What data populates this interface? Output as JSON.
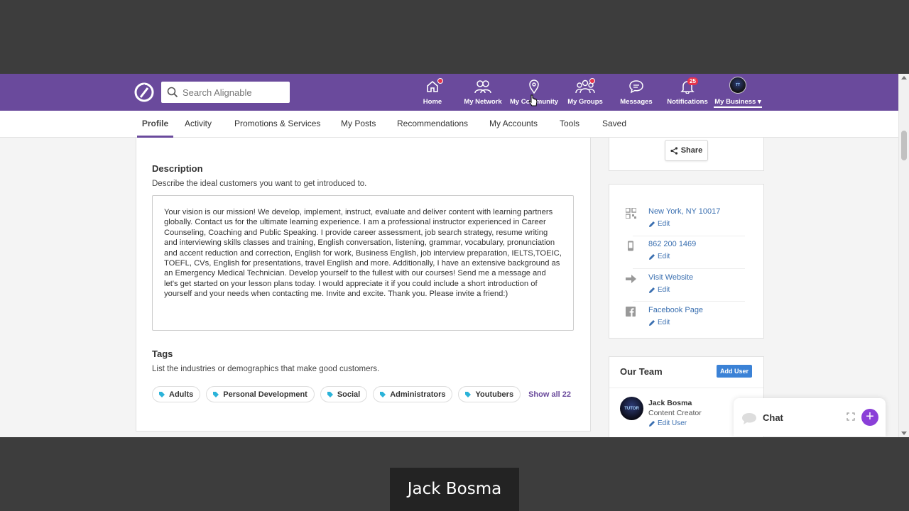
{
  "search": {
    "placeholder": "Search Alignable"
  },
  "nav": [
    {
      "label": "Home",
      "icon": "home-icon"
    },
    {
      "label": "My Network",
      "icon": "network-icon"
    },
    {
      "label": "My Community",
      "icon": "location-pin-icon"
    },
    {
      "label": "My Groups",
      "icon": "groups-icon"
    },
    {
      "label": "Messages",
      "icon": "chat-bubble-icon"
    },
    {
      "label": "Notifications",
      "icon": "bell-icon",
      "badge": "25"
    },
    {
      "label": "My Business",
      "icon": "business-avatar"
    }
  ],
  "tabs": [
    "Profile",
    "Activity",
    "Promotions & Services",
    "My Posts",
    "Recommendations",
    "My Accounts",
    "Tools",
    "Saved"
  ],
  "description": {
    "title": "Description",
    "subtitle": "Describe the ideal customers you want to get introduced to.",
    "text": "Your vision is our mission! We develop, implement, instruct, evaluate and deliver content with learning partners globally. Contact us for the ultimate learning experience. I am a professional instructor experienced in Career Counseling, Coaching and Public Speaking. I provide career assessment, job search strategy, resume writing and interviewing skills classes and training, English conversation, listening, grammar, vocabulary, pronunciation and accent reduction and correction, English for work, Business English, job interview preparation, IELTS,TOEIC, TOEFL, CVs, English for presentations, travel English and more. Additionally, I have an extensive background as an Emergency Medical Technician. Develop yourself to the fullest with our courses! Send me a message and let's get started on your lesson plans today. I would appreciate it if you could include a short introduction of yourself and your needs when contacting me. Invite and excite. Thank you. Please invite a friend:)"
  },
  "tags": {
    "title": "Tags",
    "subtitle": "List the industries or demographics that make good customers.",
    "items": [
      "Adults",
      "Personal Development",
      "Social",
      "Administrators",
      "Youtubers"
    ],
    "show_all": "Show all 22"
  },
  "share": {
    "label": "Share"
  },
  "contact": {
    "location": "New York, NY 10017",
    "phone": "862 200 1469",
    "website": "Visit Website",
    "facebook": "Facebook Page",
    "edit_label": "Edit"
  },
  "team": {
    "title": "Our Team",
    "add_user": "Add User",
    "member_name": "Jack Bosma",
    "member_role": "Content Creator",
    "edit_user": "Edit User"
  },
  "chat": {
    "label": "Chat"
  },
  "caption": "Jack Bosma",
  "colors": {
    "brand_purple": "#6a4a9c",
    "link_blue": "#3a6fb0",
    "tag_icon": "#2bb3d9",
    "badge_red": "#e8334a"
  }
}
